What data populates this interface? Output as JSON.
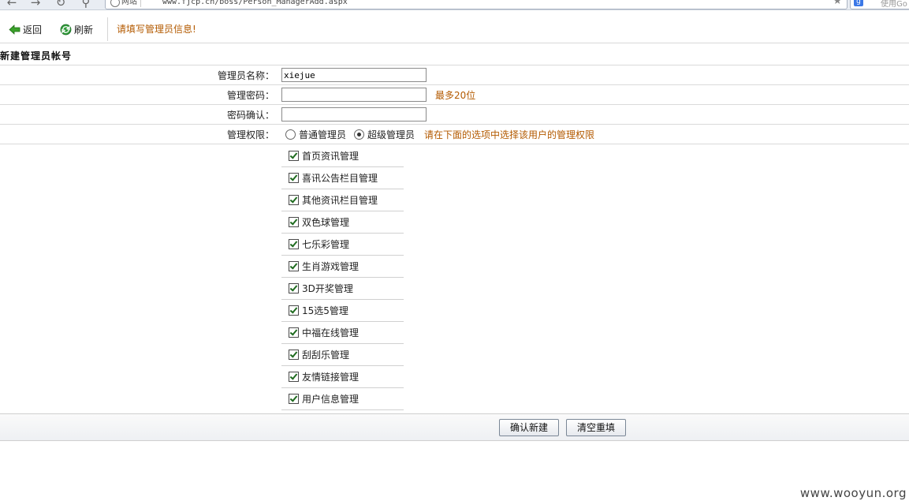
{
  "browser": {
    "site_label": "网站",
    "url": "www.fjcp.cn/boss/Person_ManagerAdd.aspx",
    "search_hint": "使用Go"
  },
  "toolbar": {
    "back_label": "返回",
    "refresh_label": "刷新",
    "hint": "请填写管理员信息!"
  },
  "form": {
    "section_title": "新建管理员帐号",
    "name_label": "管理员名称：",
    "name_value": "xiejue",
    "password_label": "管理密码：",
    "password_note": "最多20位",
    "confirm_label": "密码确认：",
    "perm_label": "管理权限：",
    "role_normal": "普通管理员",
    "role_super": "超级管理员",
    "selected_role": "super",
    "perm_note": "请在下面的选项中选择该用户的管理权限"
  },
  "permissions": [
    {
      "label": "首页资讯管理",
      "checked": true
    },
    {
      "label": "喜讯公告栏目管理",
      "checked": true
    },
    {
      "label": "其他资讯栏目管理",
      "checked": true
    },
    {
      "label": "双色球管理",
      "checked": true
    },
    {
      "label": "七乐彩管理",
      "checked": true
    },
    {
      "label": "生肖游戏管理",
      "checked": true
    },
    {
      "label": "3D开奖管理",
      "checked": true
    },
    {
      "label": "15选5管理",
      "checked": true
    },
    {
      "label": "中福在线管理",
      "checked": true
    },
    {
      "label": "刮刮乐管理",
      "checked": true
    },
    {
      "label": "友情链接管理",
      "checked": true
    },
    {
      "label": "用户信息管理",
      "checked": true
    }
  ],
  "buttons": {
    "confirm": "确认新建",
    "reset": "清空重填"
  },
  "watermark": "www.wooyun.org",
  "colors": {
    "hint_orange": "#b35a00",
    "back_arrow_green": "#3aa12a",
    "refresh_green": "#2f9a3a"
  }
}
